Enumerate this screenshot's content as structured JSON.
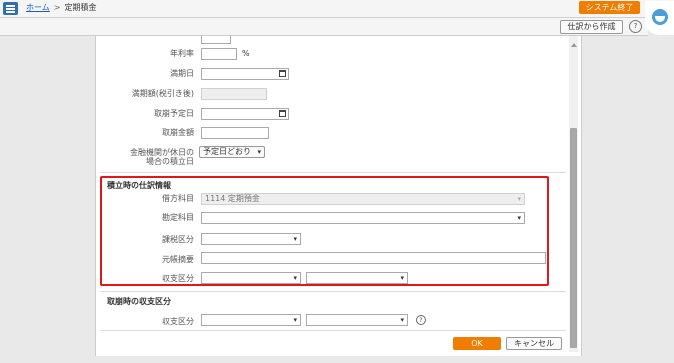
{
  "header": {
    "breadcrumb_home": "ホーム",
    "breadcrumb_sep": ">",
    "breadcrumb_current": "定期積金",
    "system_exit_label": "システム終了"
  },
  "toolbar": {
    "create_journal_label": "仕訳から作成",
    "help_symbol": "?"
  },
  "form": {
    "annual_rate_label": "年利率",
    "annual_rate_unit": "%",
    "maturity_date_label": "満期日",
    "maturity_amount_label": "満期額(税引き後)",
    "withdraw_date_label": "取崩予定日",
    "withdraw_amount_label": "取崩金額",
    "holiday_label_line1": "金融機関が休日の",
    "holiday_label_line2": "場合の積立日",
    "holiday_value": "予定日どおり"
  },
  "journal_section": {
    "title": "積立時の仕訳情報",
    "debit_label": "借方科目",
    "debit_value": "1114 定期預金",
    "account_label": "勘定科目",
    "tax_label": "課税区分",
    "memo_label": "元帳摘要",
    "balance_label": "収支区分"
  },
  "withdraw_section": {
    "title": "取崩時の収支区分",
    "balance_label": "収支区分",
    "help_symbol": "?"
  },
  "footer": {
    "ok_label": "OK",
    "cancel_label": "キャンセル"
  },
  "colors": {
    "accent_orange": "#ef7d00",
    "highlight_red": "#e01818",
    "menu_blue": "#2f6db5"
  }
}
